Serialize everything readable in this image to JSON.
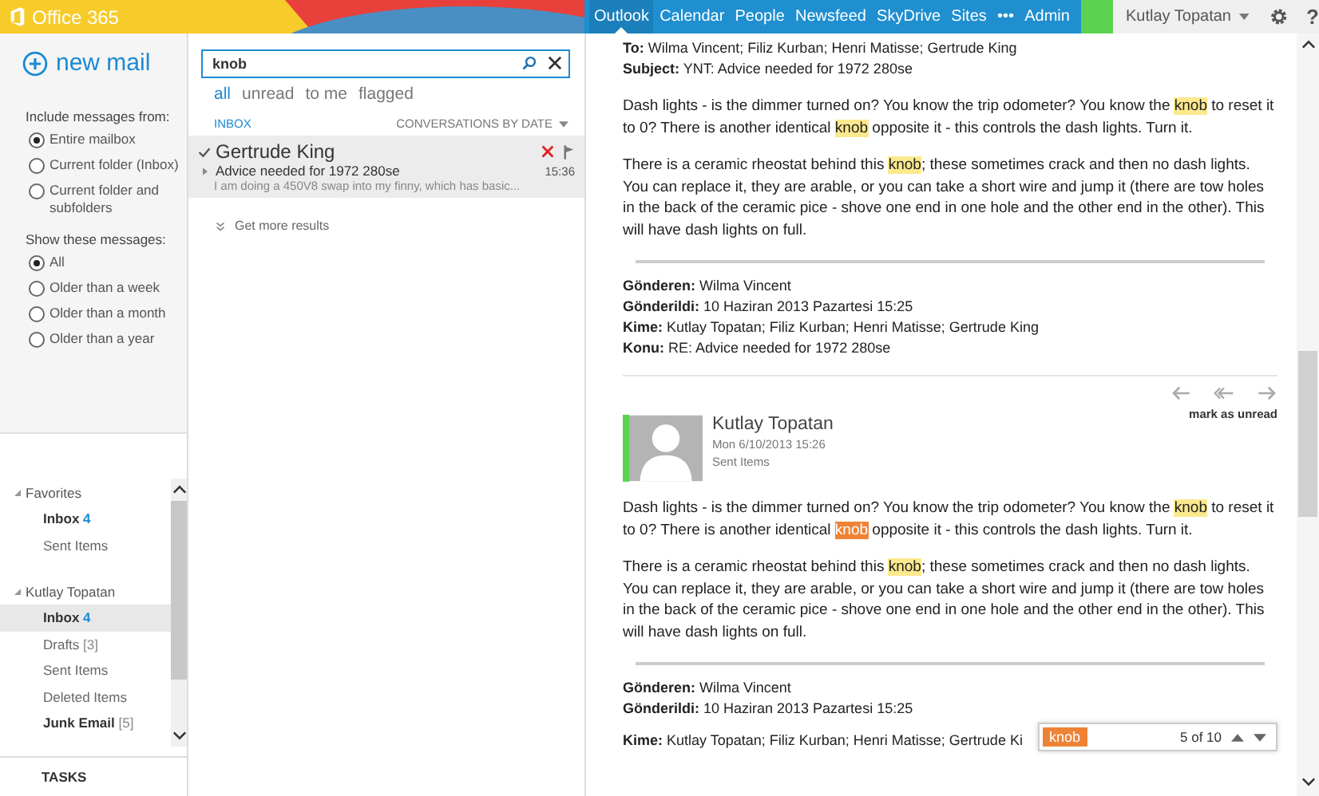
{
  "top_bar": {
    "brand": "Office 365",
    "nav": [
      {
        "label": "Outlook",
        "selected": true
      },
      {
        "label": "Calendar",
        "selected": false
      },
      {
        "label": "People",
        "selected": false
      },
      {
        "label": "Newsfeed",
        "selected": false
      },
      {
        "label": "SkyDrive",
        "selected": false
      },
      {
        "label": "Sites",
        "selected": false
      },
      {
        "label": "•••",
        "selected": false
      },
      {
        "label": "Admin",
        "selected": false
      }
    ],
    "user": "Kutlay Topatan",
    "help": "?"
  },
  "sidebar": {
    "new_mail": "new mail",
    "include_title": "Include messages from:",
    "include_options": [
      {
        "label": "Entire mailbox",
        "selected": true
      },
      {
        "label": "Current folder (Inbox)",
        "selected": false
      },
      {
        "label": "Current folder and subfolders",
        "selected": false
      }
    ],
    "show_title": "Show these messages:",
    "show_options": [
      {
        "label": "All",
        "selected": true
      },
      {
        "label": "Older than a week",
        "selected": false
      },
      {
        "label": "Older than a month",
        "selected": false
      },
      {
        "label": "Older than a year",
        "selected": false
      }
    ],
    "folder_groups": [
      {
        "label": "Favorites",
        "expanded": true,
        "children": [
          {
            "label": "Inbox",
            "count": "4",
            "count_unread": true,
            "bold": true,
            "selected": false
          },
          {
            "label": "Sent Items",
            "bold": false,
            "selected": false
          }
        ]
      },
      {
        "label": "Kutlay Topatan",
        "expanded": true,
        "children": [
          {
            "label": "Inbox",
            "count": "4",
            "count_unread": true,
            "bold": true,
            "selected": true
          },
          {
            "label": "Drafts",
            "count": "[3]",
            "count_unread": false,
            "bold": false,
            "selected": false
          },
          {
            "label": "Sent Items",
            "bold": false,
            "selected": false
          },
          {
            "label": "Deleted Items",
            "bold": false,
            "selected": false
          },
          {
            "label": "Junk Email",
            "count": "[5]",
            "count_unread": false,
            "bold": true,
            "selected": false
          }
        ]
      }
    ],
    "tasks": "TASKS"
  },
  "message_list": {
    "search": {
      "value": "knob"
    },
    "filters": [
      {
        "label": "all",
        "selected": true
      },
      {
        "label": "unread",
        "selected": false
      },
      {
        "label": "to me",
        "selected": false
      },
      {
        "label": "flagged",
        "selected": false
      }
    ],
    "folder": "INBOX",
    "sort": "CONVERSATIONS BY DATE",
    "messages": [
      {
        "sender": "Gertrude King",
        "subject": "Advice needed for 1972 280se",
        "time": "15:36",
        "preview": "I am doing a 450V8 swap into my finny, which has basic...",
        "selected": true
      }
    ],
    "more": "Get more results"
  },
  "reading_pane": {
    "first_message": {
      "header_lines": [
        "**To:** Wilma Vincent; Filiz Kurban; Henri Matisse; Gertrude King",
        "**Subject:** YNT: Advice needed for 1972 280se"
      ],
      "paragraphs": [
        [
          {
            "text": "Dash lights - is the dimmer turned on? You know the trip odometer? You know the ",
            "highlighted": false
          },
          {
            "text": "knob",
            "highlighted": true,
            "current": false
          },
          {
            "text": " to reset it to 0? There is another identical ",
            "highlighted": false
          },
          {
            "text": "knob",
            "highlighted": true,
            "current": false
          },
          {
            "text": " opposite it - this controls the dash lights. Turn it.",
            "highlighted": false
          }
        ],
        [
          {
            "text": "There is a ceramic rheostat behind this ",
            "highlighted": false
          },
          {
            "text": "knob",
            "highlighted": true,
            "current": false
          },
          {
            "text": "; these sometimes crack and then no dash lights. You can replace it, they are arable, or you can take a short wire and jump it (there are tow holes in the back of the ceramic pice - shove one end in one hole and the other end in the other). This will have dash lights on full.",
            "highlighted": false
          }
        ]
      ],
      "quote_lines": [
        "**Gönderen:** Wilma Vincent",
        "**Gönderildi:** 10 Haziran 2013 Pazartesi 15:25",
        "**Kime:** Kutlay Topatan; Filiz Kurban; Henri Matisse; Gertrude King",
        "**Konu:** RE: Advice needed for 1972 280se"
      ]
    },
    "mark_unread": "mark as unread",
    "second_message": {
      "sender": "Kutlay Topatan",
      "date": "Mon 6/10/2013 15:26",
      "folder": "Sent Items",
      "paragraphs": [
        [
          {
            "text": "Dash lights - is the dimmer turned on? You know the trip odometer? You know the ",
            "highlighted": false
          },
          {
            "text": "knob",
            "highlighted": true,
            "current": false
          },
          {
            "text": " to reset it to 0? There is another identical ",
            "highlighted": false
          },
          {
            "text": "knob",
            "highlighted": true,
            "current": true
          },
          {
            "text": " opposite it - this controls the dash lights. Turn it.",
            "highlighted": false
          }
        ],
        [
          {
            "text": "There is a ceramic rheostat behind this ",
            "highlighted": false
          },
          {
            "text": "knob",
            "highlighted": true,
            "current": false
          },
          {
            "text": "; these sometimes crack and then no dash lights. You can replace it, they are arable, or you can take a short wire and jump it (there are tow holes in the back of the ceramic pice - shove one end in one hole and the other end in the other). This will have dash lights on full.",
            "highlighted": false
          }
        ]
      ],
      "quote_lines": [
        "**Gönderen:** Wilma Vincent",
        "**Gönderildi:** 10 Haziran 2013 Pazartesi 15:25",
        "**Kime:** Kutlay Topatan; Filiz Kurban; Henri Matisse; Gertrude Ki"
      ]
    },
    "find_bar": {
      "query": "knob",
      "count": "5 of 10"
    }
  }
}
